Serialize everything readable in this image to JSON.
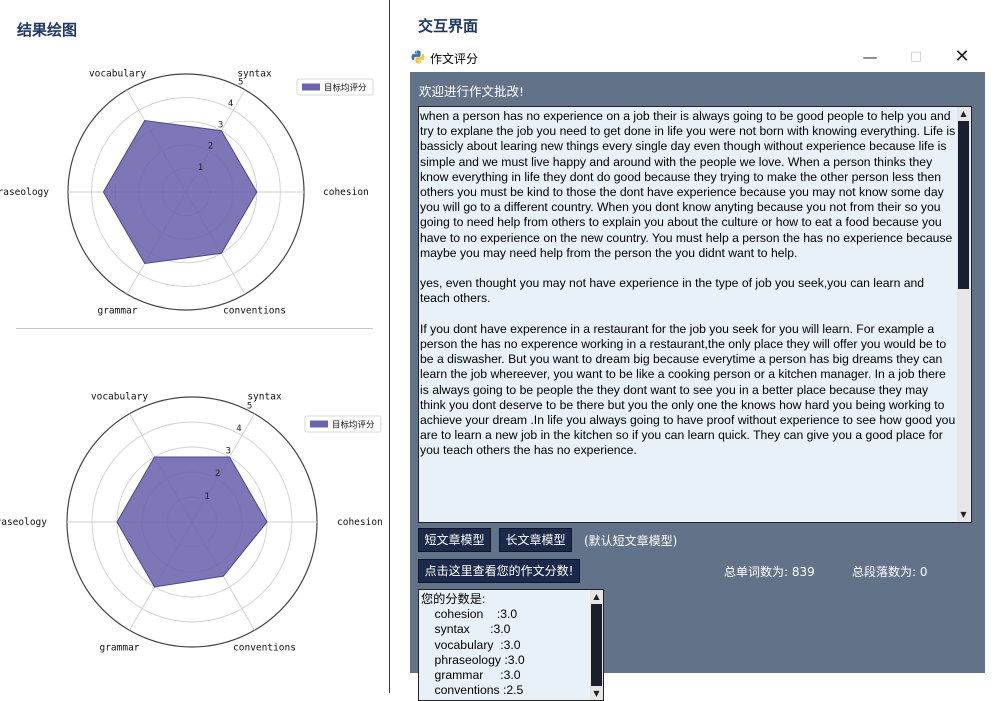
{
  "left_heading": "结果绘图",
  "right_heading": "交互界面",
  "charts": [
    {
      "type": "radar",
      "axes": [
        "cohesion",
        "syntax",
        "vocabulary",
        "phraseology",
        "grammar",
        "conventions"
      ],
      "values": [
        3.0,
        3.0,
        3.5,
        3.5,
        3.5,
        3.0
      ],
      "rlim": [
        0,
        5
      ],
      "ring_labels": [
        "1",
        "2",
        "3",
        "4",
        "5"
      ],
      "legend_label": "目标均评分",
      "legend_position": "top-right",
      "fill_color": "#6b63ad"
    },
    {
      "type": "radar",
      "axes": [
        "cohesion",
        "syntax",
        "vocabulary",
        "phraseology",
        "grammar",
        "conventions"
      ],
      "values": [
        3.0,
        3.0,
        3.0,
        3.0,
        3.0,
        2.5
      ],
      "rlim": [
        0,
        5
      ],
      "ring_labels": [
        "1",
        "2",
        "3",
        "4",
        "5"
      ],
      "legend_label": "目标均评分",
      "legend_position": "top-right",
      "fill_color": "#6b63ad"
    }
  ],
  "window": {
    "title": "作文评分",
    "minimize": "—",
    "maximize": "□",
    "close": "✕",
    "welcome": "欢迎进行作文批改!",
    "essay_paragraphs": [
      "when a person has no experience on a job their is always going to be good people to help you and try to explane the job you need to get done in life you were not born with knowing everything. Life is bassicly about learing new things every single day even though without experience because life is simple and we must live happy and around with the people we love. When a person thinks they know everything in life they dont do good because they trying to make the other person less then others you must be kind to those the dont have experience because you may not know some day you will go to a different country. When you dont know anyting because you not from their so you going to need help from others to explain you about the culture or how to eat a food because you have to no experience on the new country. You must help a person the has no experience because maybe you may need help from the person the you didnt want to help.",
      "yes, even thought you may not have experience in the type of job you seek,you can learn and teach others.",
      "If you dont have experence in a restaurant for the job you seek for you will learn. For example a person the has no experence working in a restaurant,the only place they will offer you would be to be a diswasher. But you want to dream big because everytime a person has big dreams they can learn the job whereever, you want to be like a cooking person or a kitchen manager. In a job there is always going to be people the they dont want to see you in a better place because they may think you dont deserve to be there but you the only one the knows how hard you being working to achieve your dream .In life you always going to have proof without experience to see how good you are to learn a new job in the kitchen so if you can learn quick. They can give you a good place for you teach others the has no experience."
    ],
    "short_model_button": "短文章模型",
    "long_model_button": "长文章模型",
    "default_note": "(默认短文章模型)",
    "score_button": "点击这里查看您的作文分数!",
    "word_count": "总单词数为: 839",
    "paragraph_count": "总段落数为: 0",
    "score_header": "您的分数是:",
    "scores": [
      "    cohesion    :3.0",
      "    syntax      :3.0",
      "    vocabulary  :3.0",
      "    phraseology :3.0",
      "    grammar     :3.0",
      "    conventions :2.5"
    ]
  },
  "colors": {
    "window_bg": "#627288",
    "text_area_bg": "#e8f1f7",
    "button_bg": "#1b2a4a",
    "heading_color": "#1f3864",
    "radar_fill": "#6b63ad"
  }
}
